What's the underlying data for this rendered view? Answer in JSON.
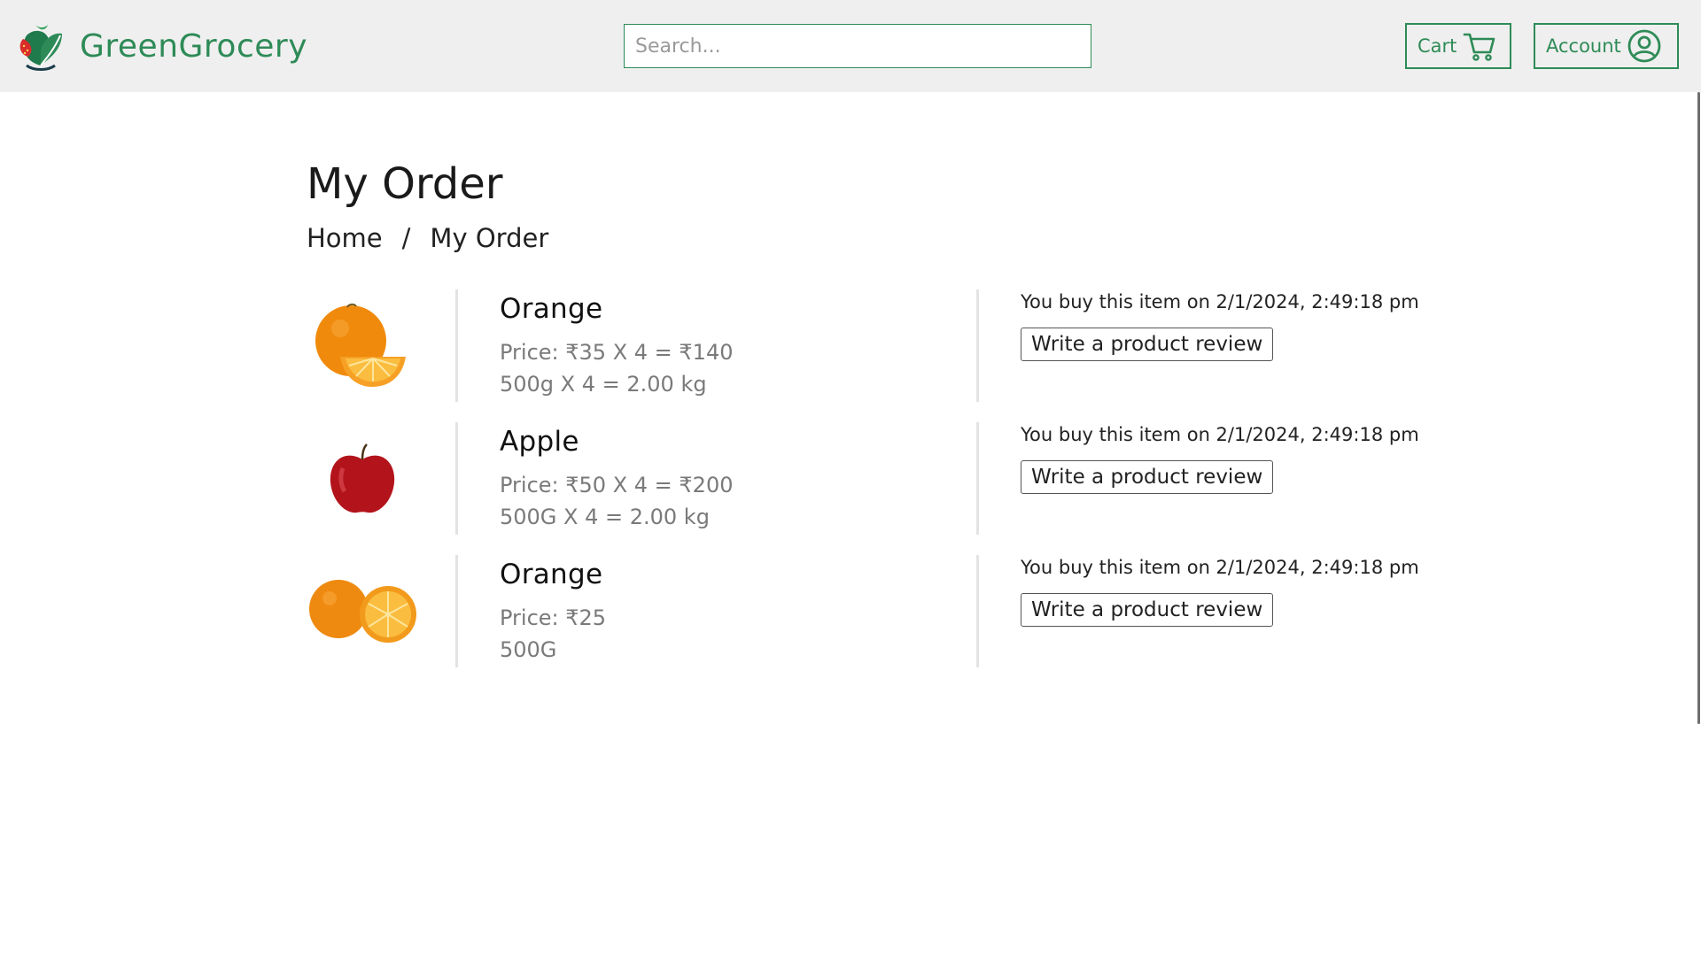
{
  "header": {
    "brand": "GreenGrocery",
    "search_placeholder": "Search...",
    "cart_label": "Cart",
    "account_label": "Account"
  },
  "page": {
    "title": "My Order",
    "breadcrumb": {
      "home": "Home",
      "separator": "/",
      "current": "My Order"
    }
  },
  "orders": [
    {
      "name": "Orange",
      "price": "Price: ₹35 X 4 = ₹140",
      "weight": "500g X 4 = 2.00 kg",
      "purchased": "You buy this item on 2/1/2024, 2:49:18 pm",
      "review_label": "Write a product review",
      "image_icon": "orange-icon"
    },
    {
      "name": "Apple",
      "price": "Price: ₹50 X 4 = ₹200",
      "weight": "500G X 4 = 2.00 kg",
      "purchased": "You buy this item on 2/1/2024, 2:49:18 pm",
      "review_label": "Write a product review",
      "image_icon": "apple-icon"
    },
    {
      "name": "Orange",
      "price": "Price: ₹25",
      "weight": "500G",
      "purchased": "You buy this item on 2/1/2024, 2:49:18 pm",
      "review_label": "Write a product review",
      "image_icon": "oranges-icon"
    }
  ],
  "colors": {
    "brand": "#2e8b57",
    "header_bg": "#efefef",
    "muted_text": "#7a7a7a"
  }
}
